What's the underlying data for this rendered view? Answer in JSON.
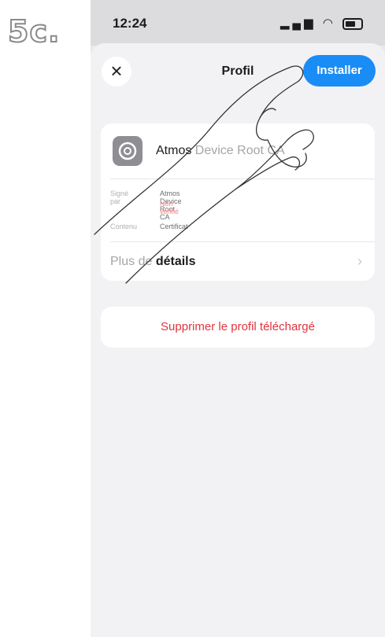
{
  "step_label": "5c.",
  "status_bar": {
    "time": "12:24"
  },
  "header": {
    "title": "Profil",
    "install_label": "Installer"
  },
  "profile": {
    "name_bold": "Atmos",
    "name_rest": " Device Root CA",
    "signed_by_label": "Signé par",
    "signed_by_value": "Atmos Device Root CA",
    "verification": "Non vérifié",
    "content_label": "Contenu",
    "content_value": "Certificat",
    "details_prefix": "Plus de ",
    "details_bold": "détails"
  },
  "actions": {
    "delete_label": "Supprimer le profil téléchargé"
  },
  "colors": {
    "accent": "#1a8cf5",
    "destructive": "#e0343f"
  }
}
